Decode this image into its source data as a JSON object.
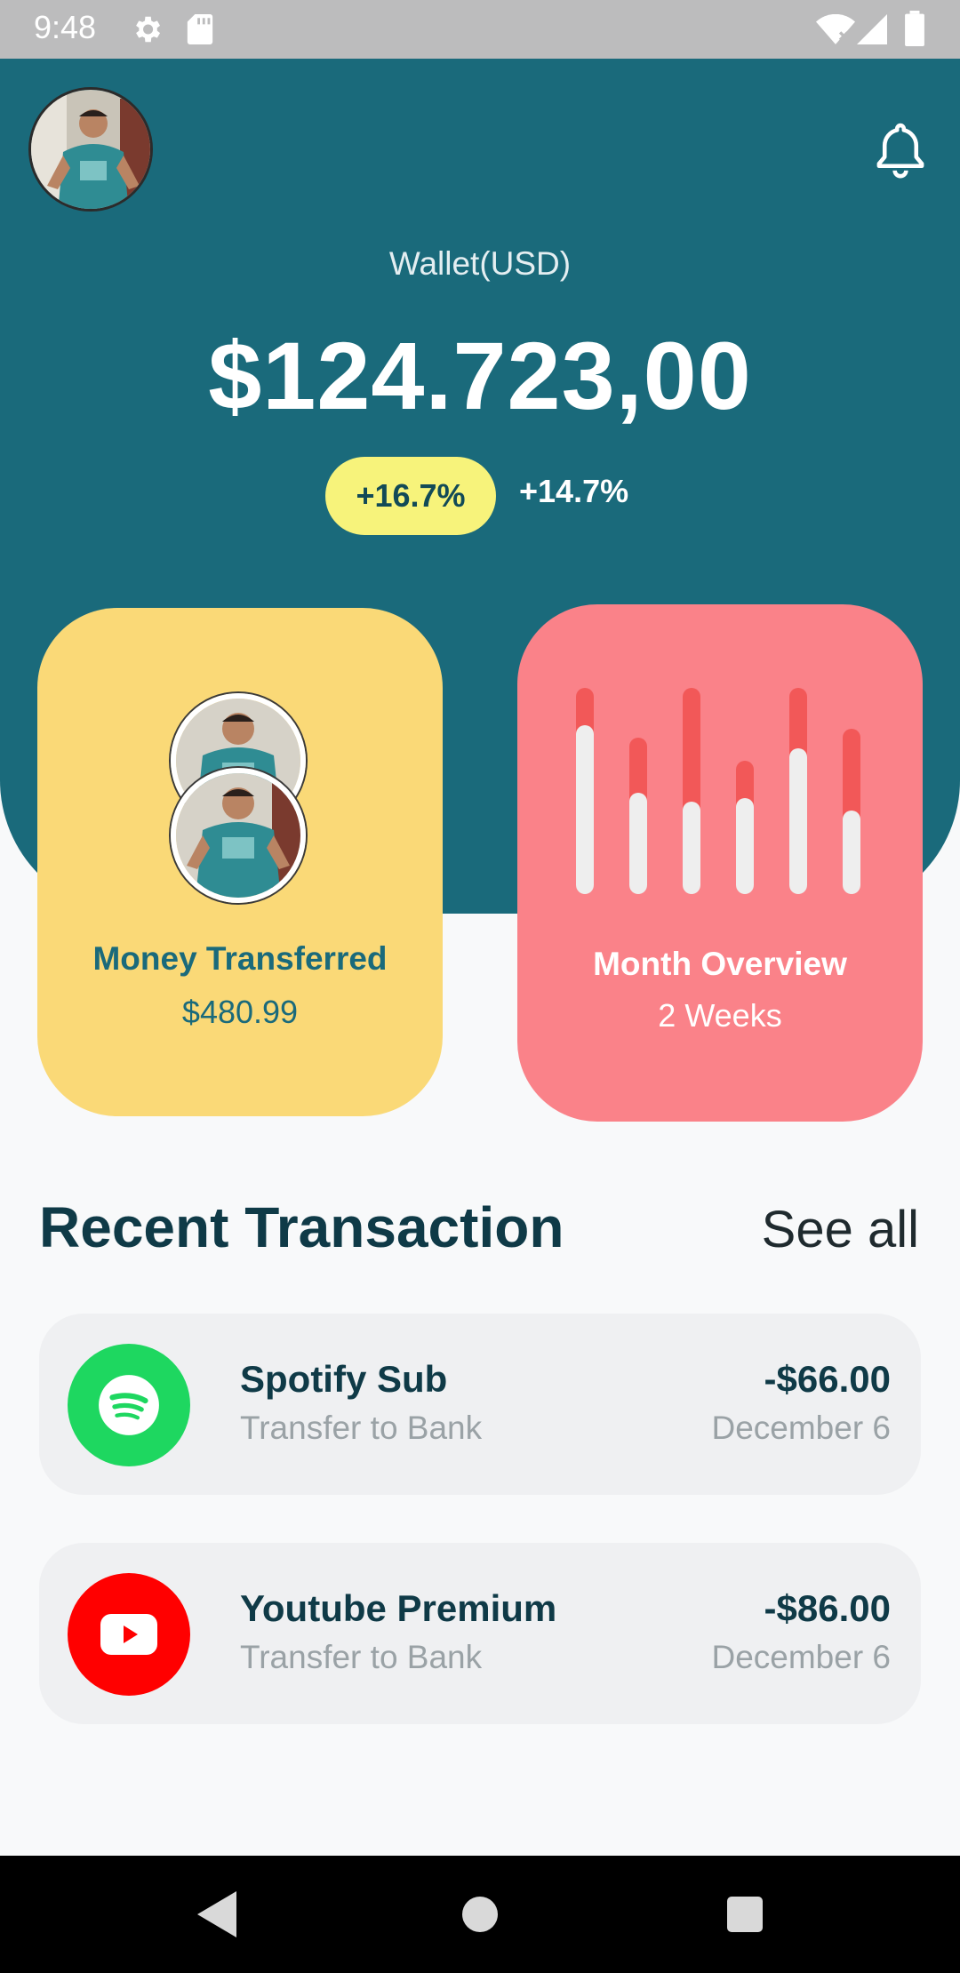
{
  "status_bar": {
    "time": "9:48"
  },
  "header": {
    "wallet_label": "Wallet(USD)",
    "balance": "$124.723,00",
    "change_badge": "+16.7%",
    "change_secondary": "+14.7%"
  },
  "cards": {
    "money_transferred": {
      "title": "Money Transferred",
      "value": "$480.99"
    },
    "month_overview": {
      "title": "Month Overview",
      "subtitle": "2 Weeks"
    }
  },
  "recent": {
    "title": "Recent Transaction",
    "see_all": "See all",
    "transactions": [
      {
        "name": "Spotify Sub",
        "subtitle": "Transfer to Bank",
        "amount": "-$66.00",
        "date": "December 6",
        "icon": "spotify-icon"
      },
      {
        "name": "Youtube Premium",
        "subtitle": "Transfer to Bank",
        "amount": "-$86.00",
        "date": "December 6",
        "icon": "youtube-icon"
      }
    ]
  },
  "colors": {
    "header_bg": "#1a6a7b",
    "badge_bg": "#f7f37b",
    "card_yellow": "#fad977",
    "card_red": "#fa8289",
    "bar_red": "#f25858",
    "spotify_green": "#1ed760",
    "youtube_red": "#ff0000"
  }
}
